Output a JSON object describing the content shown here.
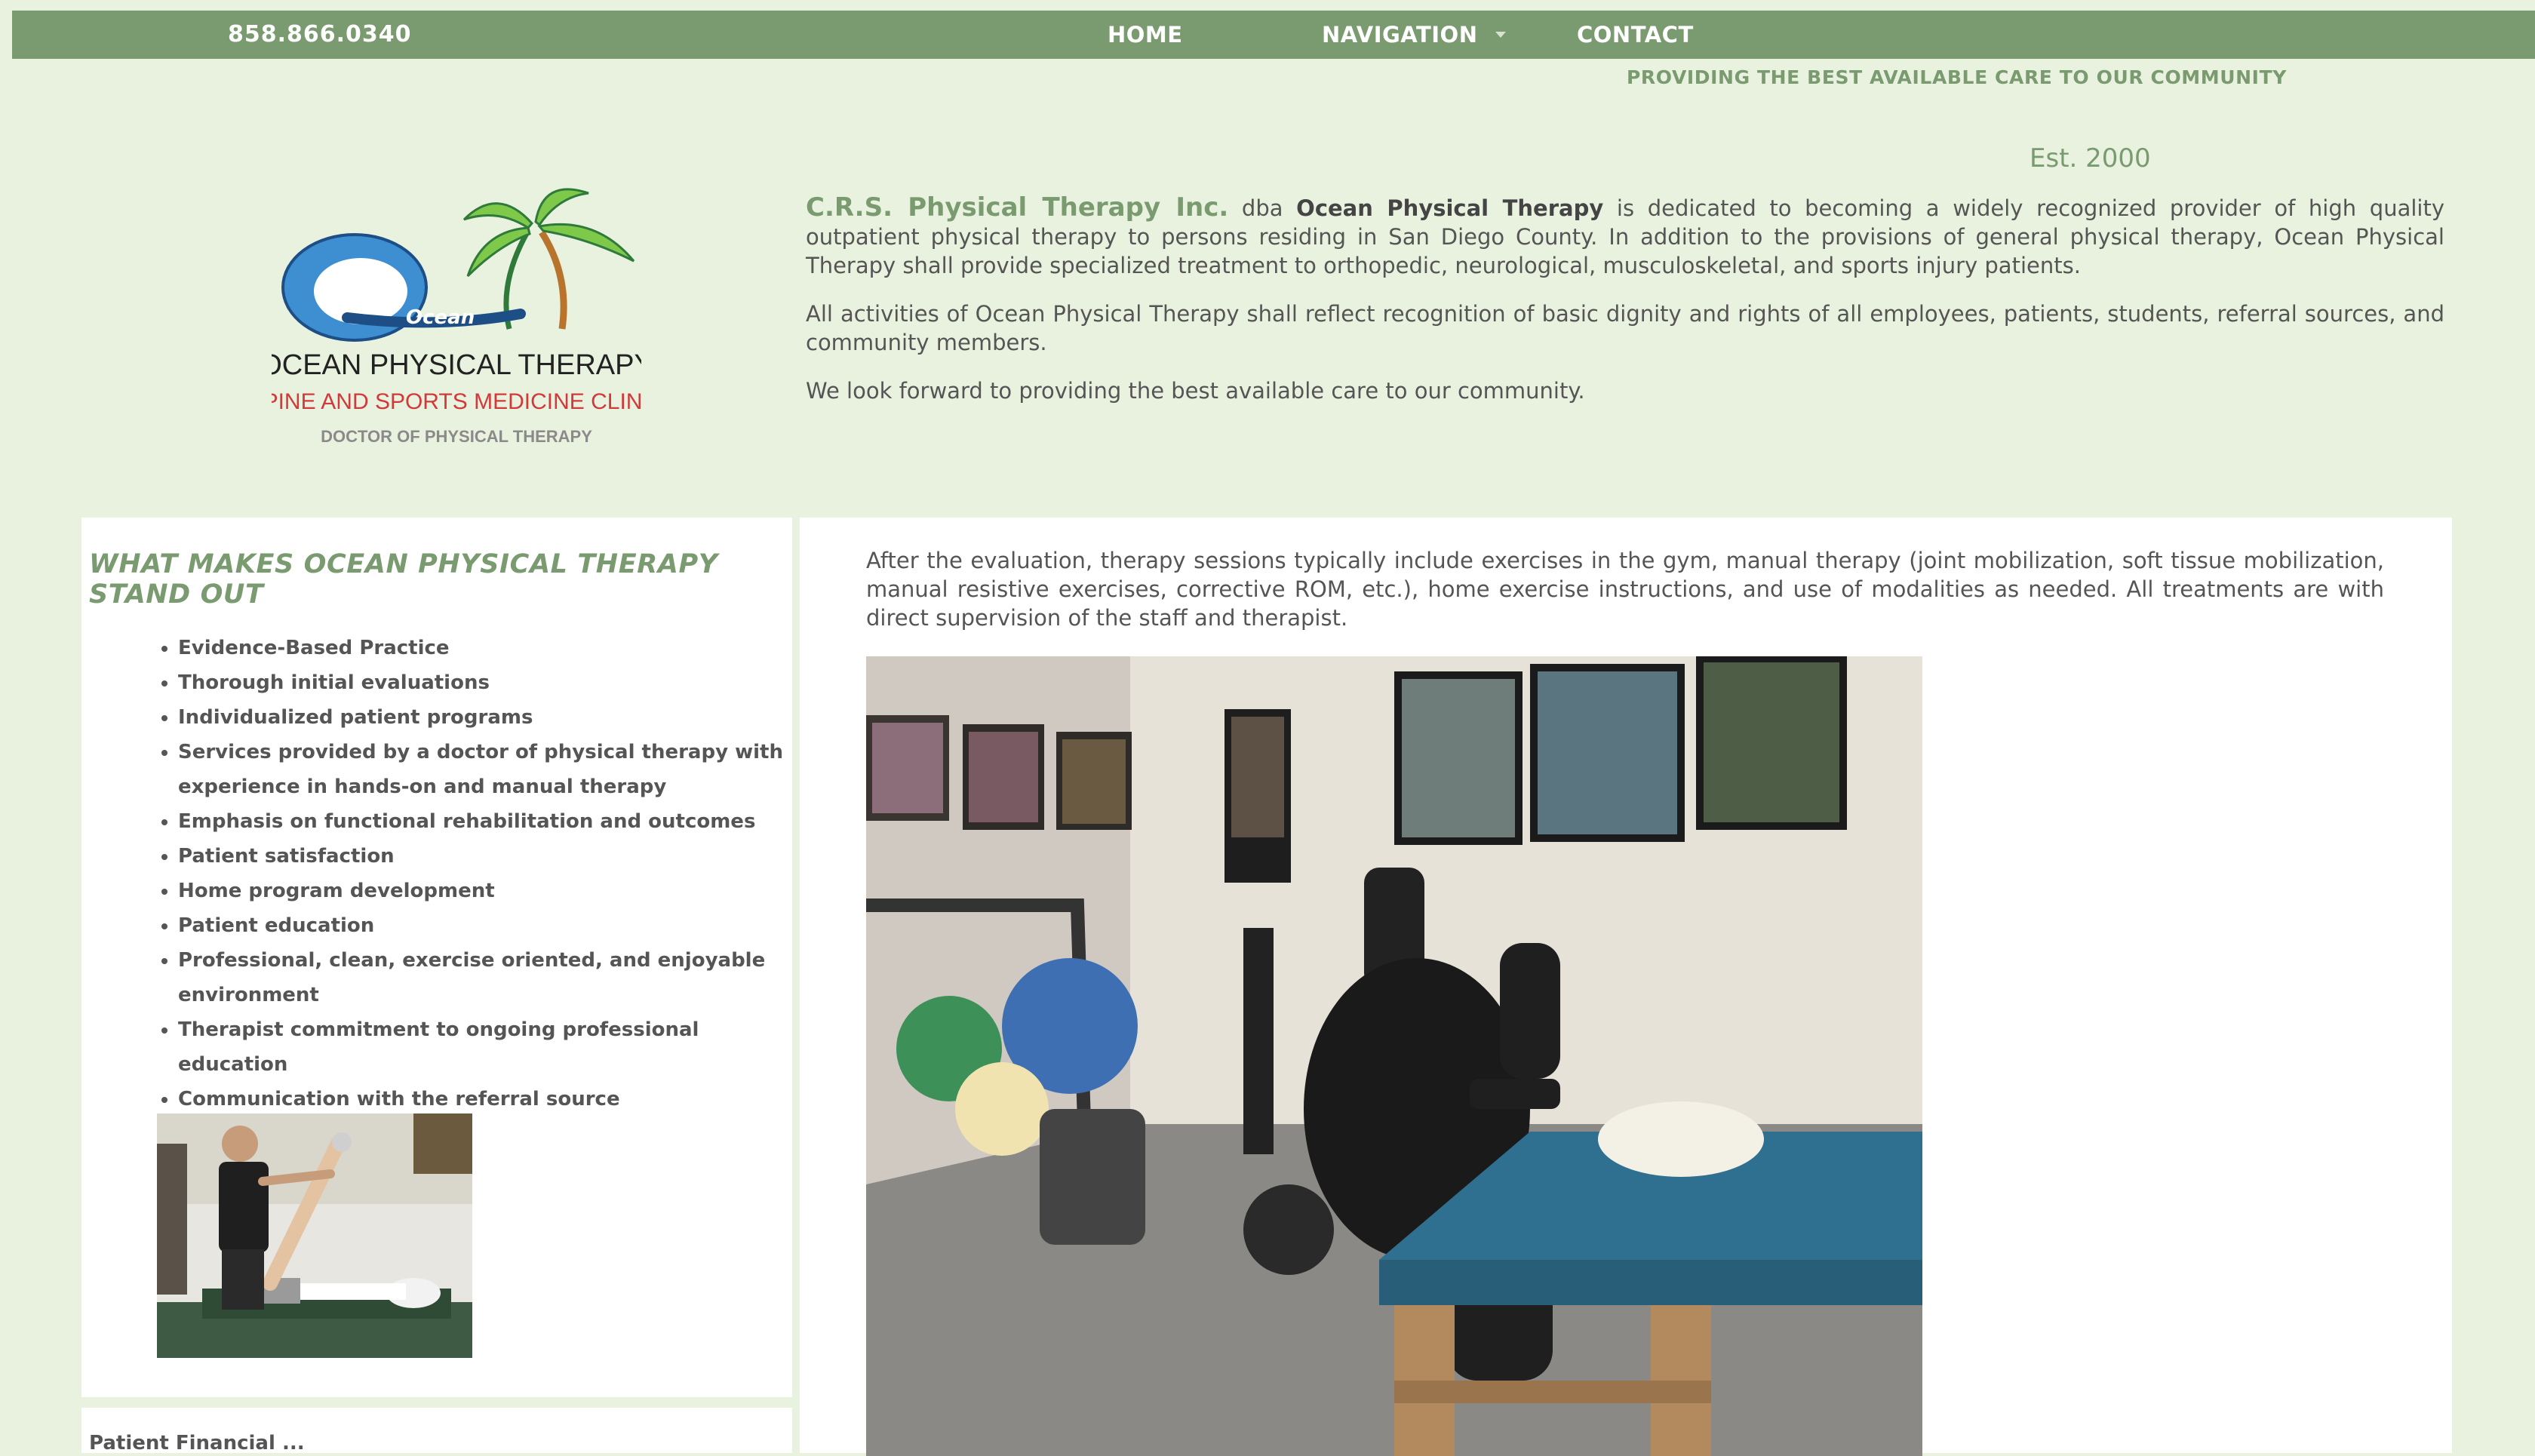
{
  "header": {
    "phone": "858.866.0340",
    "nav": [
      {
        "label": "HOME"
      },
      {
        "label": "NAVIGATION"
      },
      {
        "label": "CONTACT"
      }
    ],
    "tagline": "PROVIDING THE BEST AVAILABLE CARE TO OUR COMMUNITY",
    "established": "Est. 2000"
  },
  "logo": {
    "wordmark": "Ocean",
    "title": "OCEAN PHYSICAL THERAPY",
    "subtitle": "SPINE AND SPORTS MEDICINE CLINIC",
    "credential": "DOCTOR OF PHYSICAL THERAPY"
  },
  "intro": {
    "company": "C.R.S. Physical Therapy Inc.",
    "dba": " dba ",
    "brand": "Ocean Physical Therapy",
    "p1_rest": " is dedicated to becoming a widely recognized provider of high quality outpatient physical therapy to persons residing in San Diego County. In addition to the provisions of general physical therapy, Ocean Physical Therapy shall provide specialized treatment to orthopedic, neurological, musculoskeletal, and sports injury patients.",
    "p2": "All activities of Ocean Physical Therapy shall reflect recognition of basic dignity and rights of all employees, patients, students, referral sources, and community members.",
    "p3": "We look forward to providing the best available care to our community."
  },
  "stand_out": {
    "title": "WHAT MAKES OCEAN PHYSICAL THERAPY STAND OUT",
    "items": [
      "Evidence-Based Practice",
      "Thorough initial evaluations",
      "Individualized patient programs",
      "Services provided by a doctor of physical therapy with experience in hands-on and manual therapy",
      "Emphasis on functional rehabilitation and outcomes",
      "Patient satisfaction",
      "Home program development",
      "Patient education",
      "Professional, clean, exercise oriented, and enjoyable environment",
      "Therapist commitment to ongoing professional education",
      "Communication with the referral source"
    ]
  },
  "next_panel_cut_text": "Patient Financial ...",
  "sessions": {
    "text": "After the evaluation, therapy sessions typically include exercises in the gym, manual therapy (joint mobilization, soft tissue mobilization, manual resistive exercises, corrective ROM, etc.), home exercise instructions, and use of modalities as needed. All treatments are with direct supervision of the staff and therapist."
  },
  "colors": {
    "page_bg": "#e9f2df",
    "accent": "#7a9a70",
    "text": "#555555"
  }
}
